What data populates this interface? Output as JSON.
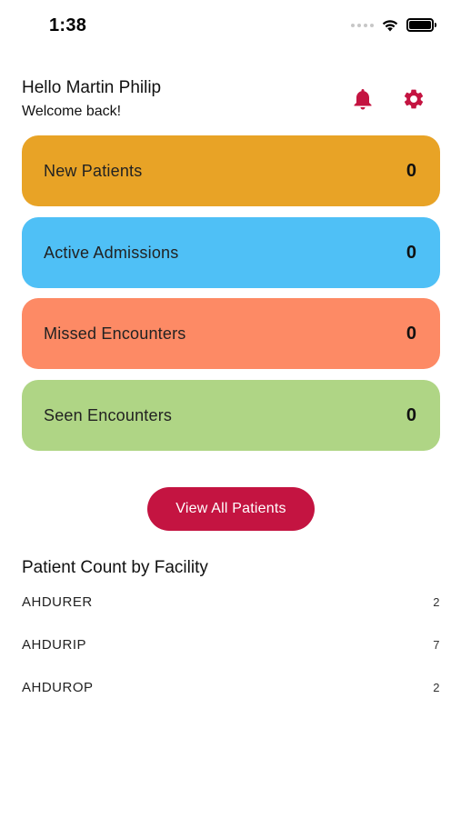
{
  "status_bar": {
    "time": "1:38"
  },
  "header": {
    "greeting": "Hello Martin Philip",
    "subtitle": "Welcome back!",
    "bell_icon": "bell-icon",
    "gear_icon": "gear-icon",
    "icon_color": "#c41441"
  },
  "cards": [
    {
      "label": "New Patients",
      "value": "0",
      "color": "#e8a326"
    },
    {
      "label": "Active Admissions",
      "value": "0",
      "color": "#4fc0f6"
    },
    {
      "label": "Missed Encounters",
      "value": "0",
      "color": "#fd8a65"
    },
    {
      "label": "Seen Encounters",
      "value": "0",
      "color": "#afd585"
    }
  ],
  "view_all_button": {
    "label": "View All Patients",
    "color": "#c41441"
  },
  "facility_section": {
    "title": "Patient Count by Facility",
    "rows": [
      {
        "name": "AHDURER",
        "count": "2"
      },
      {
        "name": "AHDURIP",
        "count": "7"
      },
      {
        "name": "AHDUROP",
        "count": "2"
      }
    ]
  }
}
